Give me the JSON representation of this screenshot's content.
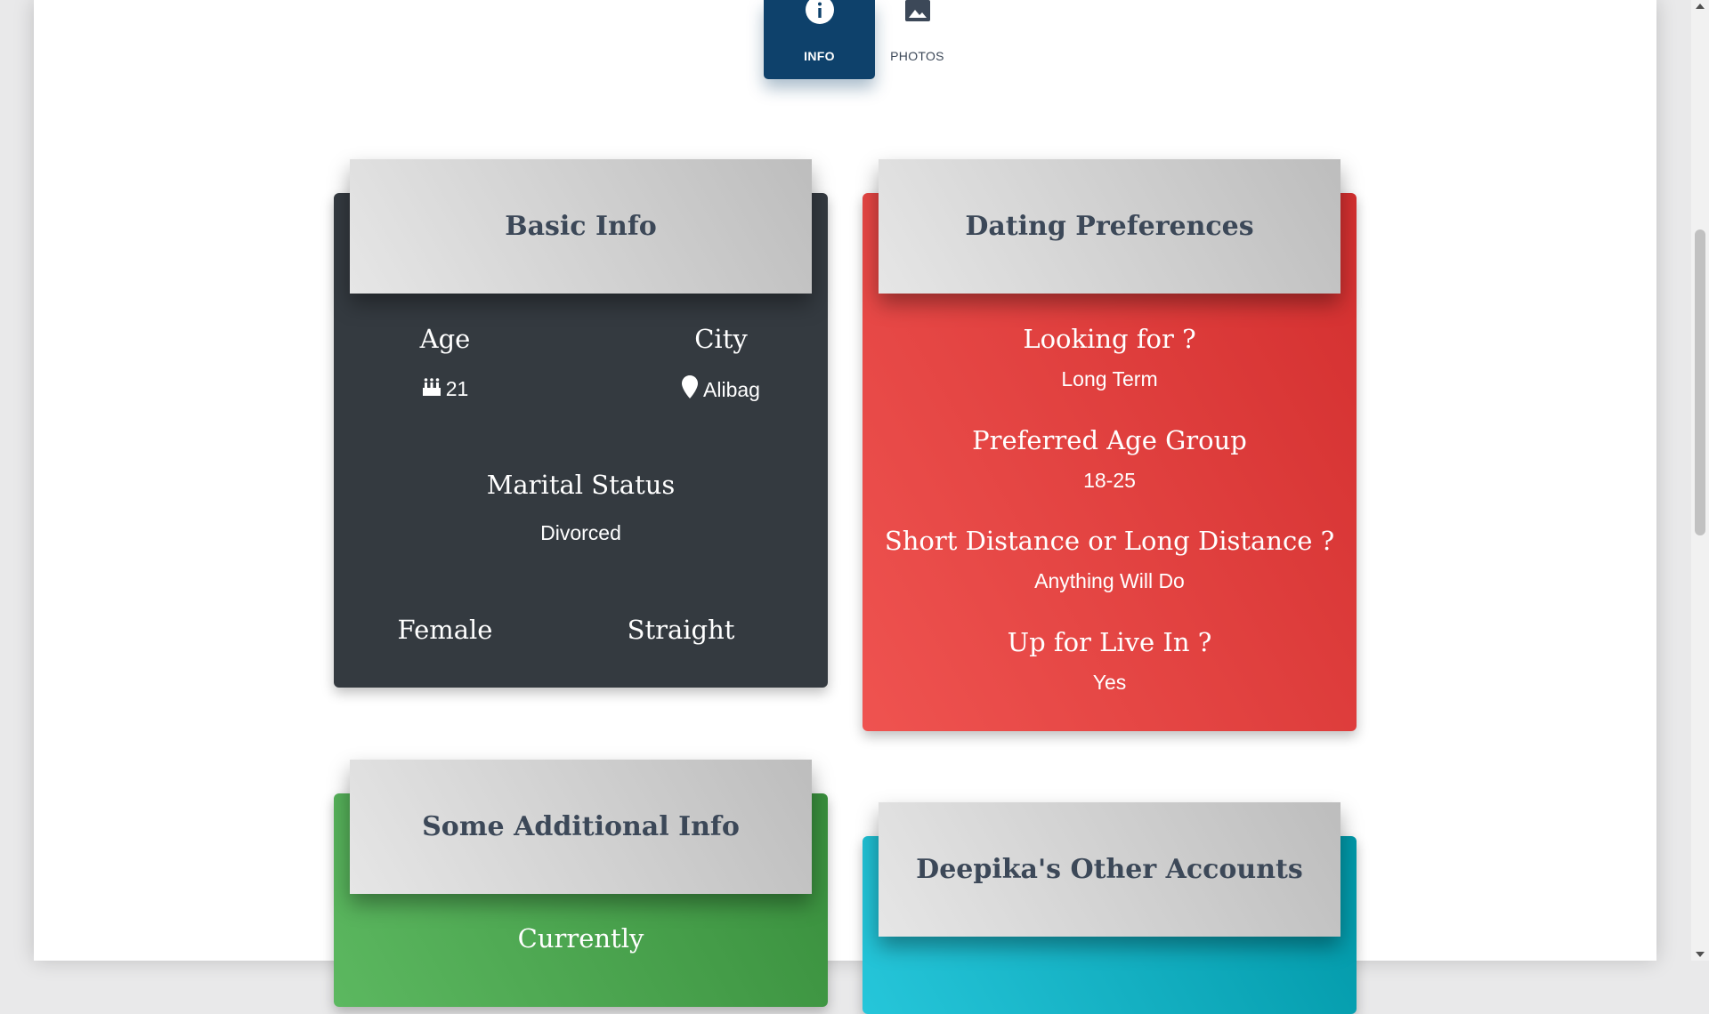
{
  "tabs": [
    {
      "label": "INFO",
      "icon": "info-icon",
      "active": true
    },
    {
      "label": "PHOTOS",
      "icon": "image-icon",
      "active": false
    }
  ],
  "basic_info": {
    "title": "Basic Info",
    "age_label": "Age",
    "age_value": "21",
    "age_icon": "birthday-cake-icon",
    "city_label": "City",
    "city_value": "Alibag",
    "city_icon": "map-marker-icon",
    "marital_label": "Marital Status",
    "marital_value": "Divorced",
    "gender": "Female",
    "orientation": "Straight"
  },
  "dating_preferences": {
    "title": "Dating Preferences",
    "items": [
      {
        "label": "Looking for ?",
        "value": "Long Term"
      },
      {
        "label": "Preferred Age Group",
        "value": "18-25"
      },
      {
        "label": "Short Distance or Long Distance ?",
        "value": "Anything Will Do"
      },
      {
        "label": "Up for Live In ?",
        "value": "Yes"
      }
    ]
  },
  "additional_info": {
    "title": "Some Additional Info",
    "first_label": "Currently"
  },
  "other_accounts": {
    "title": "Deepika's Other Accounts"
  },
  "colors": {
    "tab_active": "#0e416b",
    "basic_card": "#343a40",
    "dating_card": "#e53935",
    "additional_card": "#43a047",
    "accounts_card": "#00acc1"
  }
}
